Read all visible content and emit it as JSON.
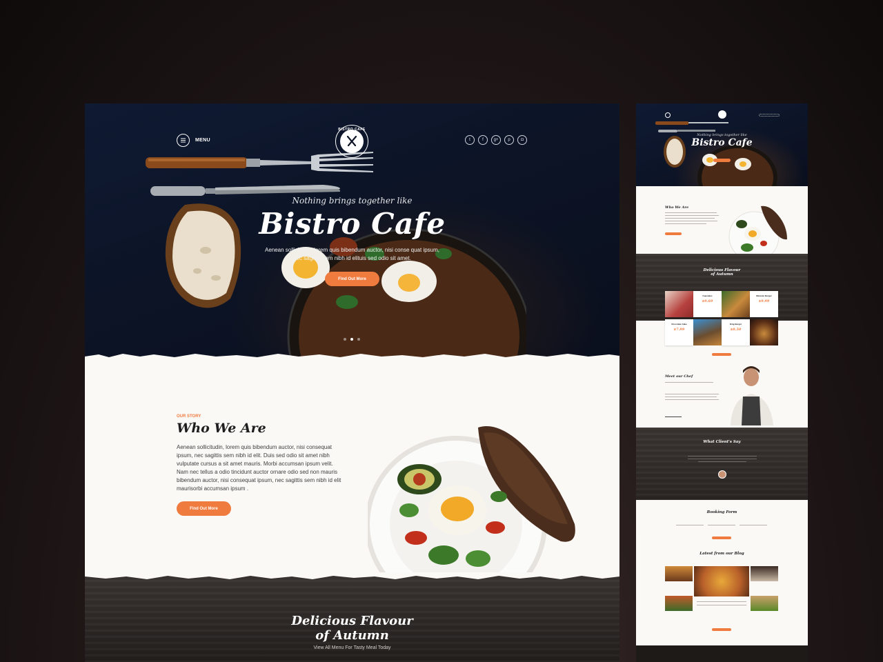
{
  "main": {
    "menu_label": "MENU",
    "logo_text": "BISTRO CAFE",
    "social_icons": [
      "twitter-icon",
      "facebook-icon",
      "google-plus-icon",
      "pinterest-icon",
      "instagram-icon"
    ],
    "social_glyphs": [
      "t",
      "f",
      "g+",
      "p",
      "◘"
    ],
    "hero": {
      "subtitle": "Nothing brings together like",
      "title": "Bistro Cafe",
      "description": "Aenean sollicitudin, lorem quis bibendum auctor, nisi conse quat ipsum, nec sagittis sem nibh id elituis sed odio sit amet.",
      "button": "Find Out More",
      "slides": 3,
      "active_slide": 2
    },
    "who": {
      "eyebrow": "OUR STORY",
      "title": "Who We Are",
      "text": "Aenean sollicitudin, lorem quis bibendum auctor, nisi consequat ipsum, nec sagittis sem nibh id elit. Duis sed odio sit amet nibh vulputate cursus a sit amet mauris. Morbi accumsan ipsum velit. Nam nec tellus a odio tincidunt auctor ornare odio sed non mauris bibendum auctor, nisi consequat ipsum, nec sagittis sem nibh id elit maurisorbi accumsan ipsum .",
      "button": "Find Out More"
    },
    "menu_section": {
      "title_line1": "Delicious Flavour",
      "title_line2": "of Autumn",
      "subtitle": "View All Menu For Tasty Meal Today"
    }
  },
  "side": {
    "hero_subtitle": "Nothing brings together like",
    "hero_title": "Bistro Cafe",
    "who_title": "Who We Are",
    "menu_title_line1": "Delicious Flavour",
    "menu_title_line2": "of Autumn",
    "menu_items": [
      {
        "name": "Cupcakes",
        "price": "$9.69"
      },
      {
        "name": "Mexican Burger",
        "price": "$9.99"
      },
      {
        "name": "Chocolate Cake",
        "price": "$7.99"
      },
      {
        "name": "King Burger",
        "price": "$8.50"
      }
    ],
    "chef_title": "Meet our Chef",
    "testimonials_title": "What Client's Say",
    "booking_title": "Booking Form",
    "blog_title": "Latest from our Blog"
  },
  "colors": {
    "accent": "#f07b3f",
    "hero_bg": "#0c1426",
    "wood": "#2c2725",
    "paper": "#faf9f6"
  }
}
